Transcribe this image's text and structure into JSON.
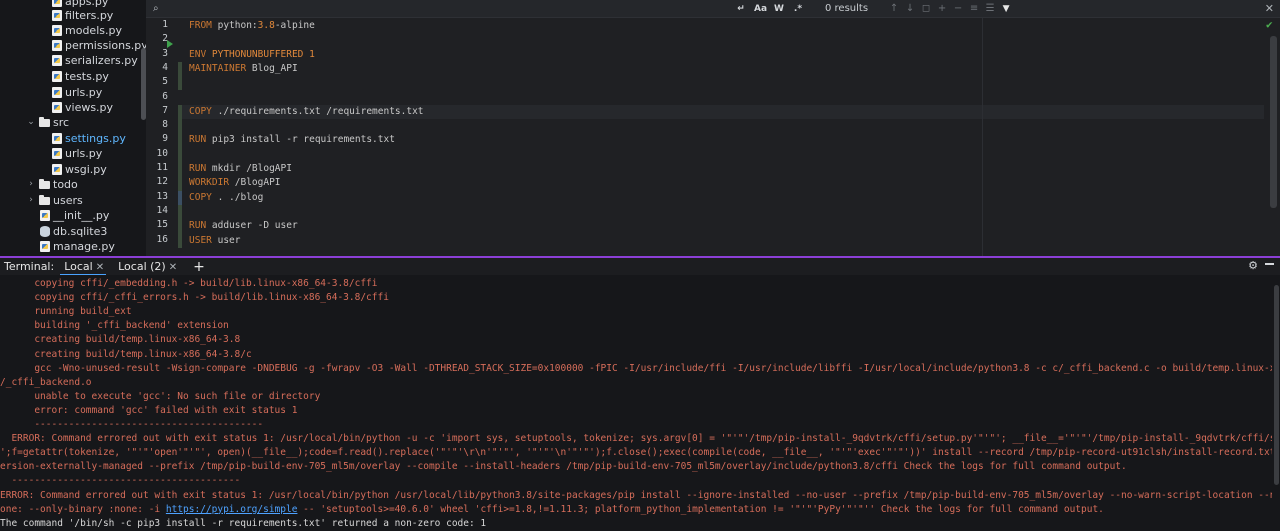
{
  "tree": {
    "items": [
      {
        "label": "apps.py",
        "type": "py"
      },
      {
        "label": "filters.py",
        "type": "py"
      },
      {
        "label": "models.py",
        "type": "py"
      },
      {
        "label": "permissions.py",
        "type": "py"
      },
      {
        "label": "serializers.py",
        "type": "py"
      },
      {
        "label": "tests.py",
        "type": "py"
      },
      {
        "label": "urls.py",
        "type": "py"
      },
      {
        "label": "views.py",
        "type": "py"
      },
      {
        "label": "src",
        "type": "folder-open"
      },
      {
        "label": "settings.py",
        "type": "py"
      },
      {
        "label": "urls.py",
        "type": "py"
      },
      {
        "label": "wsgi.py",
        "type": "py"
      },
      {
        "label": "todo",
        "type": "folder"
      },
      {
        "label": "users",
        "type": "folder"
      },
      {
        "label": "__init__.py",
        "type": "py"
      },
      {
        "label": "db.sqlite3",
        "type": "db"
      },
      {
        "label": "manage.py",
        "type": "py"
      }
    ]
  },
  "find": {
    "results": "0 results",
    "case_label": "Aa",
    "word_label": "W",
    "regex_label": ".*"
  },
  "editor": {
    "lines": [
      {
        "n": "1",
        "parts": [
          {
            "c": "kw",
            "t": "FROM "
          },
          {
            "c": "tx",
            "t": "python:"
          },
          {
            "c": "tg",
            "t": "3.8"
          },
          {
            "c": "tx",
            "t": "-alpine"
          }
        ]
      },
      {
        "n": "2",
        "parts": []
      },
      {
        "n": "3",
        "parts": [
          {
            "c": "kw",
            "t": "ENV "
          },
          {
            "c": "tg",
            "t": "PYTHONUNBUFFERED 1"
          }
        ]
      },
      {
        "n": "4",
        "parts": [
          {
            "c": "kw",
            "t": "MAINTAINER "
          },
          {
            "c": "tx",
            "t": "Blog_API"
          }
        ]
      },
      {
        "n": "5",
        "parts": []
      },
      {
        "n": "6",
        "parts": []
      },
      {
        "n": "7",
        "parts": [
          {
            "c": "kw",
            "t": "COPY "
          },
          {
            "c": "tx",
            "t": "./requirements.txt /requirements.txt"
          }
        ]
      },
      {
        "n": "8",
        "parts": []
      },
      {
        "n": "9",
        "parts": [
          {
            "c": "kw",
            "t": "RUN "
          },
          {
            "c": "tx",
            "t": "pip3 install -r requirements.txt"
          }
        ]
      },
      {
        "n": "10",
        "parts": []
      },
      {
        "n": "11",
        "parts": [
          {
            "c": "kw",
            "t": "RUN "
          },
          {
            "c": "tx",
            "t": "mkdir /BlogAPI"
          }
        ]
      },
      {
        "n": "12",
        "parts": [
          {
            "c": "kw",
            "t": "WORKDIR "
          },
          {
            "c": "tx",
            "t": "/BlogAPI"
          }
        ]
      },
      {
        "n": "13",
        "parts": [
          {
            "c": "kw",
            "t": "COPY "
          },
          {
            "c": "tx",
            "t": ". ./blog"
          }
        ]
      },
      {
        "n": "14",
        "parts": []
      },
      {
        "n": "15",
        "parts": [
          {
            "c": "kw",
            "t": "RUN "
          },
          {
            "c": "tx",
            "t": "adduser -D user"
          }
        ]
      },
      {
        "n": "16",
        "parts": [
          {
            "c": "kw",
            "t": "USER "
          },
          {
            "c": "tx",
            "t": "user"
          }
        ]
      }
    ]
  },
  "terminal": {
    "title": "Terminal:",
    "tabs": [
      {
        "label": "Local"
      },
      {
        "label": "Local (2)"
      }
    ],
    "lines": [
      {
        "t": "      copying cffi/_embedding.h -> build/lib.linux-x86_64-3.8/cffi"
      },
      {
        "t": "      copying cffi/_cffi_errors.h -> build/lib.linux-x86_64-3.8/cffi"
      },
      {
        "t": "      running build_ext"
      },
      {
        "t": "      building '_cffi_backend' extension"
      },
      {
        "t": "      creating build/temp.linux-x86_64-3.8"
      },
      {
        "t": "      creating build/temp.linux-x86_64-3.8/c"
      },
      {
        "t": "      gcc -Wno-unused-result -Wsign-compare -DNDEBUG -g -fwrapv -O3 -Wall -DTHREAD_STACK_SIZE=0x100000 -fPIC -I/usr/include/ffi -I/usr/include/libffi -I/usr/local/include/python3.8 -c c/_cffi_backend.c -o build/temp.linux-x86_64-3.8/c"
      },
      {
        "t": "/_cffi_backend.o"
      },
      {
        "t": "      unable to execute 'gcc': No such file or directory"
      },
      {
        "t": "      error: command 'gcc' failed with exit status 1"
      },
      {
        "t": "      ----------------------------------------"
      },
      {
        "t": "  ERROR: Command errored out with exit status 1: /usr/local/bin/python -u -c 'import sys, setuptools, tokenize; sys.argv[0] = '\"'\"'/tmp/pip-install-_9qdvtrk/cffi/setup.py'\"'\"'; __file__='\"'\"'/tmp/pip-install-_9qdvtrk/cffi/setup.py'\"'\""
      },
      {
        "t": "';f=getattr(tokenize, '\"'\"'open'\"'\"', open)(__file__);code=f.read().replace('\"'\"'\\r\\n'\"'\"', '\"'\"'\\n'\"'\"');f.close();exec(compile(code, __file__, '\"'\"'exec'\"'\"'))' install --record /tmp/pip-record-ut91clsh/install-record.txt --single-v"
      },
      {
        "t": "ersion-externally-managed --prefix /tmp/pip-build-env-705_ml5m/overlay --compile --install-headers /tmp/pip-build-env-705_ml5m/overlay/include/python3.8/cffi Check the logs for full command output."
      },
      {
        "t": "  ----------------------------------------"
      },
      {
        "t": "ERROR: Command errored out with exit status 1: /usr/local/bin/python /usr/local/lib/python3.8/site-packages/pip install --ignore-installed --no-user --prefix /tmp/pip-build-env-705_ml5m/overlay --no-warn-script-location --no-binary :n"
      },
      {
        "t": "one: --only-binary :none: -i ",
        "link": "https://pypi.org/simple",
        "after": " -- 'setuptools>=40.6.0' wheel 'cffi>=1.8,!=1.11.3; platform_python_implementation != '\"'\"'PyPy'\"'\"'' Check the logs for full command output."
      },
      {
        "t": "The command '/bin/sh -c pip3 install -r requirements.txt' returned a non-zero code: 1",
        "white": true
      }
    ]
  }
}
